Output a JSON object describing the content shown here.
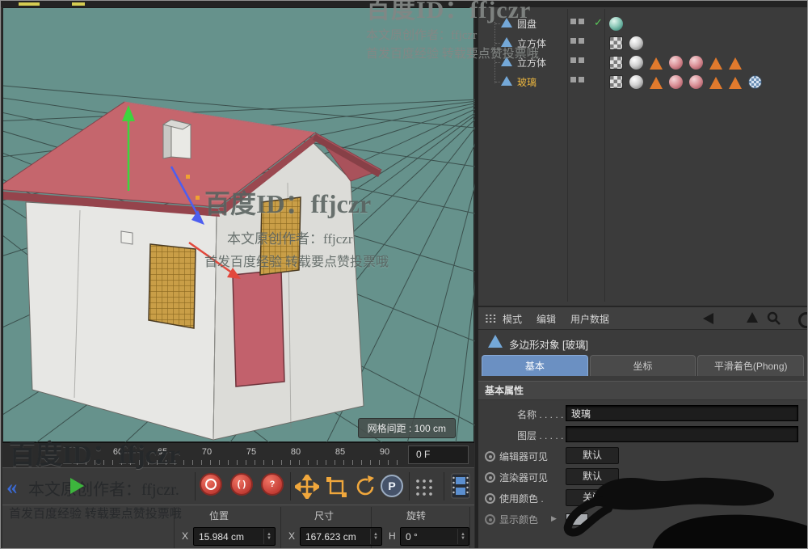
{
  "viewport": {
    "grid_spacing_label": "网格间距 : 100 cm"
  },
  "watermarks": {
    "top": {
      "line1": "百度ID：ffjczr",
      "line2": "本文原创作者：ffjczr",
      "line3": "首发百度经验 转载要点赞投票哦"
    },
    "center": {
      "line1": "百度ID：ffjczr",
      "line2": "本文原创作者：ffjczr",
      "line3": "首发百度经验 转载要点赞投票哦"
    },
    "bottom": {
      "chevron": "«",
      "line1": "百度ID：ffjczr",
      "line2": "本文原创作者：ffjczr.",
      "line3": "首发百度经验 转载要点赞投票哦"
    }
  },
  "object_manager": {
    "rows": [
      {
        "label": "圆盘",
        "check": "✓",
        "materials": [
          "teal-sphere"
        ]
      },
      {
        "label": "立方体",
        "check": "",
        "materials": [
          "checker",
          "white-sphere"
        ]
      },
      {
        "label": "立方体",
        "check": "",
        "materials": [
          "checker",
          "white-sphere",
          "orange-triangle",
          "pink-sphere",
          "pink-sphere",
          "orange-triangle",
          "orange-triangle"
        ]
      },
      {
        "label": "玻璃",
        "check": "",
        "materials": [
          "checker",
          "white-sphere",
          "orange-triangle",
          "pink-sphere",
          "pink-sphere",
          "orange-triangle",
          "orange-triangle",
          "blue-checker-sphere"
        ]
      }
    ]
  },
  "attribute_manager": {
    "menu": {
      "mode": "模式",
      "edit": "编辑",
      "user_data": "用户数据"
    },
    "object_title": "多边形对象 [玻璃]",
    "tabs": [
      {
        "label": "基本"
      },
      {
        "label": "坐标"
      },
      {
        "label": "平滑着色(Phong)"
      }
    ],
    "section_title": "基本属性",
    "rows": {
      "name": {
        "label": "名称 . . . . .",
        "value": "玻璃"
      },
      "layer": {
        "label": "图层 . . . . .",
        "value": ""
      },
      "editor": {
        "label": "编辑器可见",
        "value": "默认"
      },
      "render": {
        "label": "渲染器可见",
        "value": "默认"
      },
      "use_color": {
        "label": "使用颜色 .",
        "value": "关闭"
      },
      "display_color": {
        "label": "显示颜色",
        "arrow": "▶"
      }
    }
  },
  "timeline": {
    "ticks": [
      "60",
      "65",
      "70",
      "75",
      "80",
      "85",
      "90"
    ],
    "frame_value": "0 F"
  },
  "toolbar": {
    "record2": "( )",
    "record3": "?",
    "p_label": "P"
  },
  "transform": {
    "headers": [
      "位置",
      "尺寸",
      "旋转"
    ],
    "fields": [
      {
        "axis": "X",
        "value": "15.984 cm"
      },
      {
        "axis": "X",
        "value": "167.623 cm"
      },
      {
        "axis": "H",
        "value": "0 °"
      }
    ]
  },
  "icons": {
    "step_up": "▲",
    "step_down": "▼"
  },
  "colors": {
    "accent_orange": "#e9b43f",
    "tab_active_blue": "#6b90c2",
    "viewport_teal": "#66928c",
    "roof_red": "#c5666d"
  }
}
